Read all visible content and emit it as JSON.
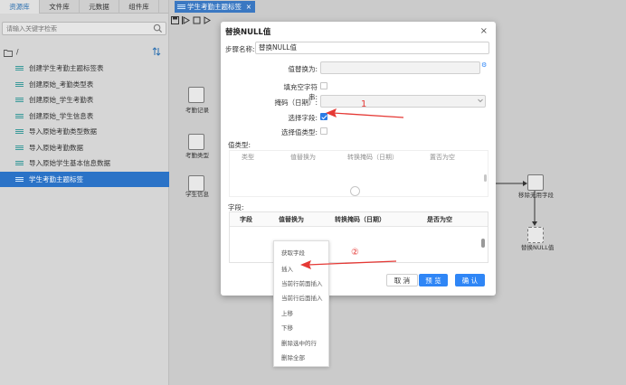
{
  "left_panel": {
    "tabs": [
      "资源库",
      "文件库",
      "元数据",
      "组件库"
    ],
    "search_placeholder": "请输入关键字检索",
    "root_label": "/",
    "items": [
      "创建学生考勤主题标签表",
      "创建原始_考勤类型表",
      "创建原始_学生考勤表",
      "创建原始_学生信息表",
      "导入原始考勤类型数据",
      "导入原始考勤数据",
      "导入原始学生基本信息数据",
      "学生考勤主题标签"
    ],
    "selected_index": 7
  },
  "main": {
    "doc_tab": "学生考勤主题标签",
    "nodes": {
      "kaoqin_jilu": "考勤记录",
      "kaoqin_leixing": "考勤类型",
      "xuesheng_xinxi": "学生信息",
      "yichu_ziduan": "移除无用字段",
      "tihuan_null": "替换NULL值"
    }
  },
  "dialog": {
    "title": "替换NULL值",
    "step_name_label": "步骤名称:",
    "step_name_value": "替换NULL值",
    "replace_with_label": "值替换为:",
    "fill_empty_label": "填充空字符串:",
    "mask_label": "掩码（日期）:",
    "select_fields_label": "选择字段:",
    "select_value_types_label": "选择值类型:",
    "value_types_section": "值类型:",
    "value_types_columns": [
      "类型",
      "值替换为",
      "转换掩码（日期）",
      "置否为空"
    ],
    "fields_section": "字段:",
    "fields_columns": [
      "字段",
      "值替换为",
      "转换掩码（日期）",
      "是否为空"
    ],
    "cancel": "取 消",
    "preview": "预 览",
    "confirm": "确 认"
  },
  "context_menu": [
    "获取字段",
    "插入",
    "当前行前面插入",
    "当前行后面插入",
    "上移",
    "下移",
    "删除选中的行",
    "删除全部"
  ],
  "annotations": {
    "one": "1",
    "two": "②"
  },
  "colors": {
    "accent": "#2f86f6",
    "selected": "#2b73c7",
    "annotation": "#e53935"
  }
}
